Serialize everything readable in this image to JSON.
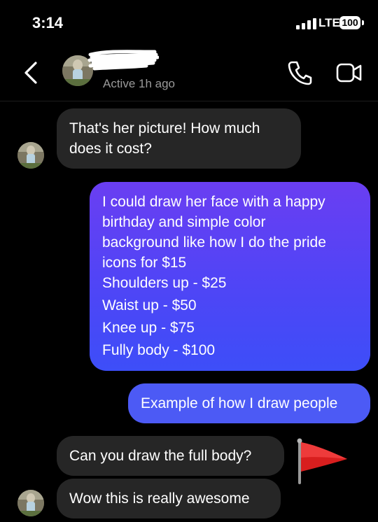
{
  "status_bar": {
    "time": "3:14",
    "network": "LTE",
    "battery": "100"
  },
  "header": {
    "active_status": "Active 1h ago"
  },
  "colors": {
    "incoming_bubble": "#262626",
    "outgoing_gradient_top": "#6a3ef2",
    "outgoing_gradient_bottom": "#3d4ef8",
    "outgoing_single": "#4c5af5",
    "flag": "#d81e1e"
  },
  "messages": {
    "m1": {
      "line1": "That's her picture! How much",
      "line2": "does it cost?"
    },
    "m2": {
      "line1": "I could draw her face with a happy",
      "line2": "birthday and simple color",
      "line3": "background like how I do the pride",
      "line4": "icons for  $15",
      "line5": "Shoulders up - $25",
      "line6": "Waist up - $50",
      "line7": "Knee up - $75",
      "line8": "Fully body - $100"
    },
    "m3": {
      "text": "Example of how I draw people"
    },
    "m4": {
      "text": "Can you draw the full body?"
    },
    "m5": {
      "text": "Wow this is really awesome"
    }
  },
  "icons": {
    "back": "chevron-left-icon",
    "call": "phone-icon",
    "video": "video-camera-icon",
    "reaction": "red-flag-icon"
  }
}
